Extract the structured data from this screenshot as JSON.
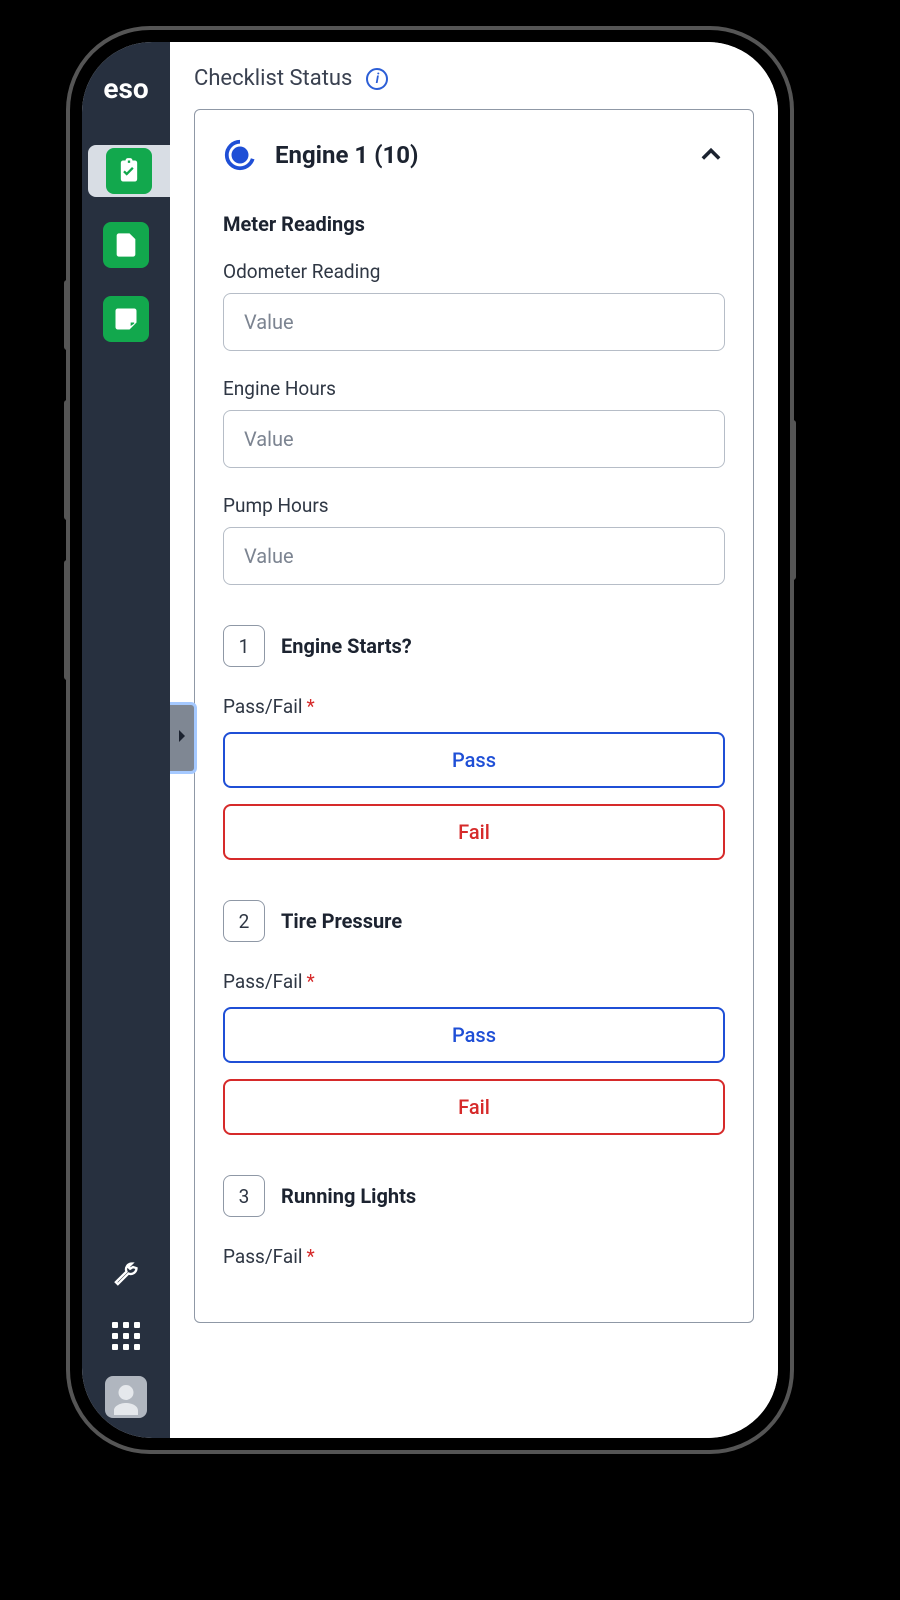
{
  "logo": "eso",
  "header": {
    "title": "Checklist Status"
  },
  "section": {
    "title": "Engine 1 (10)",
    "meter_heading": "Meter Readings",
    "fields": [
      {
        "label": "Odometer Reading",
        "placeholder": "Value"
      },
      {
        "label": "Engine Hours",
        "placeholder": "Value"
      },
      {
        "label": "Pump Hours",
        "placeholder": "Value"
      }
    ],
    "items": [
      {
        "num": "1",
        "title": "Engine Starts?"
      },
      {
        "num": "2",
        "title": "Tire Pressure"
      },
      {
        "num": "3",
        "title": "Running Lights"
      }
    ],
    "passfail_label": "Pass/Fail",
    "required_mark": "*",
    "pass_label": "Pass",
    "fail_label": "Fail"
  },
  "colors": {
    "accent_blue": "#1f4fd6",
    "accent_red": "#d62a2a",
    "sidebar_bg": "#27303f",
    "nav_green": "#12a84d"
  }
}
